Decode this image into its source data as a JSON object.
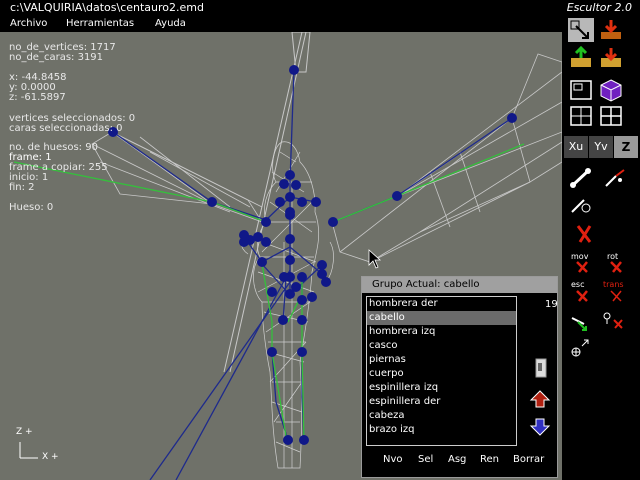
{
  "window": {
    "path": "c:\\VALQUIRIA\\datos\\centauro2.emd",
    "app_title": "Escultor 2.0"
  },
  "menu": {
    "items": [
      "Archivo",
      "Herramientas",
      "Ayuda"
    ]
  },
  "stats": {
    "vertices": "no_de_vertices: 1717",
    "caras": "no_de_caras: 3191",
    "x": "x: -44.8458",
    "y": "y: 0.0000",
    "z": "z: -61.5897",
    "vert_sel": "vertices seleccionados: 0",
    "caras_sel": "caras seleccionadas: 0",
    "huesos": "no. de huesos: 90",
    "frame": "frame: 1",
    "frame_copiar": "frame a copiar: 255",
    "inicio": "inicio: 1",
    "fin": "fin: 2",
    "hueso": "Hueso: 0"
  },
  "axes": {
    "z": "Z +",
    "x": "X +"
  },
  "toolbar": {
    "axis_buttons": [
      "Xu",
      "Yv",
      "Z"
    ],
    "labels": {
      "mov": "mov",
      "rot": "rot",
      "esc": "esc",
      "trans": "trans"
    }
  },
  "group_panel": {
    "title": "Grupo Actual: cabello",
    "count": "19",
    "selected_index": 1,
    "items": [
      "hombrera der",
      "cabello",
      "hombrera izq",
      "casco",
      "piernas",
      "cuerpo",
      "espinillera izq",
      "espinillera der",
      "cabeza",
      "brazo izq"
    ],
    "buttons": [
      "Nvo",
      "Sel",
      "Asg",
      "Ren",
      "Borrar"
    ]
  },
  "colors": {
    "viewport": "#6f7169",
    "bone": "#1e2a8c",
    "joint": "#101888",
    "green_bone": "#34c03c",
    "mesh": "#c8c8c8",
    "selection": "#6b6b6b",
    "accent_red": "#e02010"
  }
}
